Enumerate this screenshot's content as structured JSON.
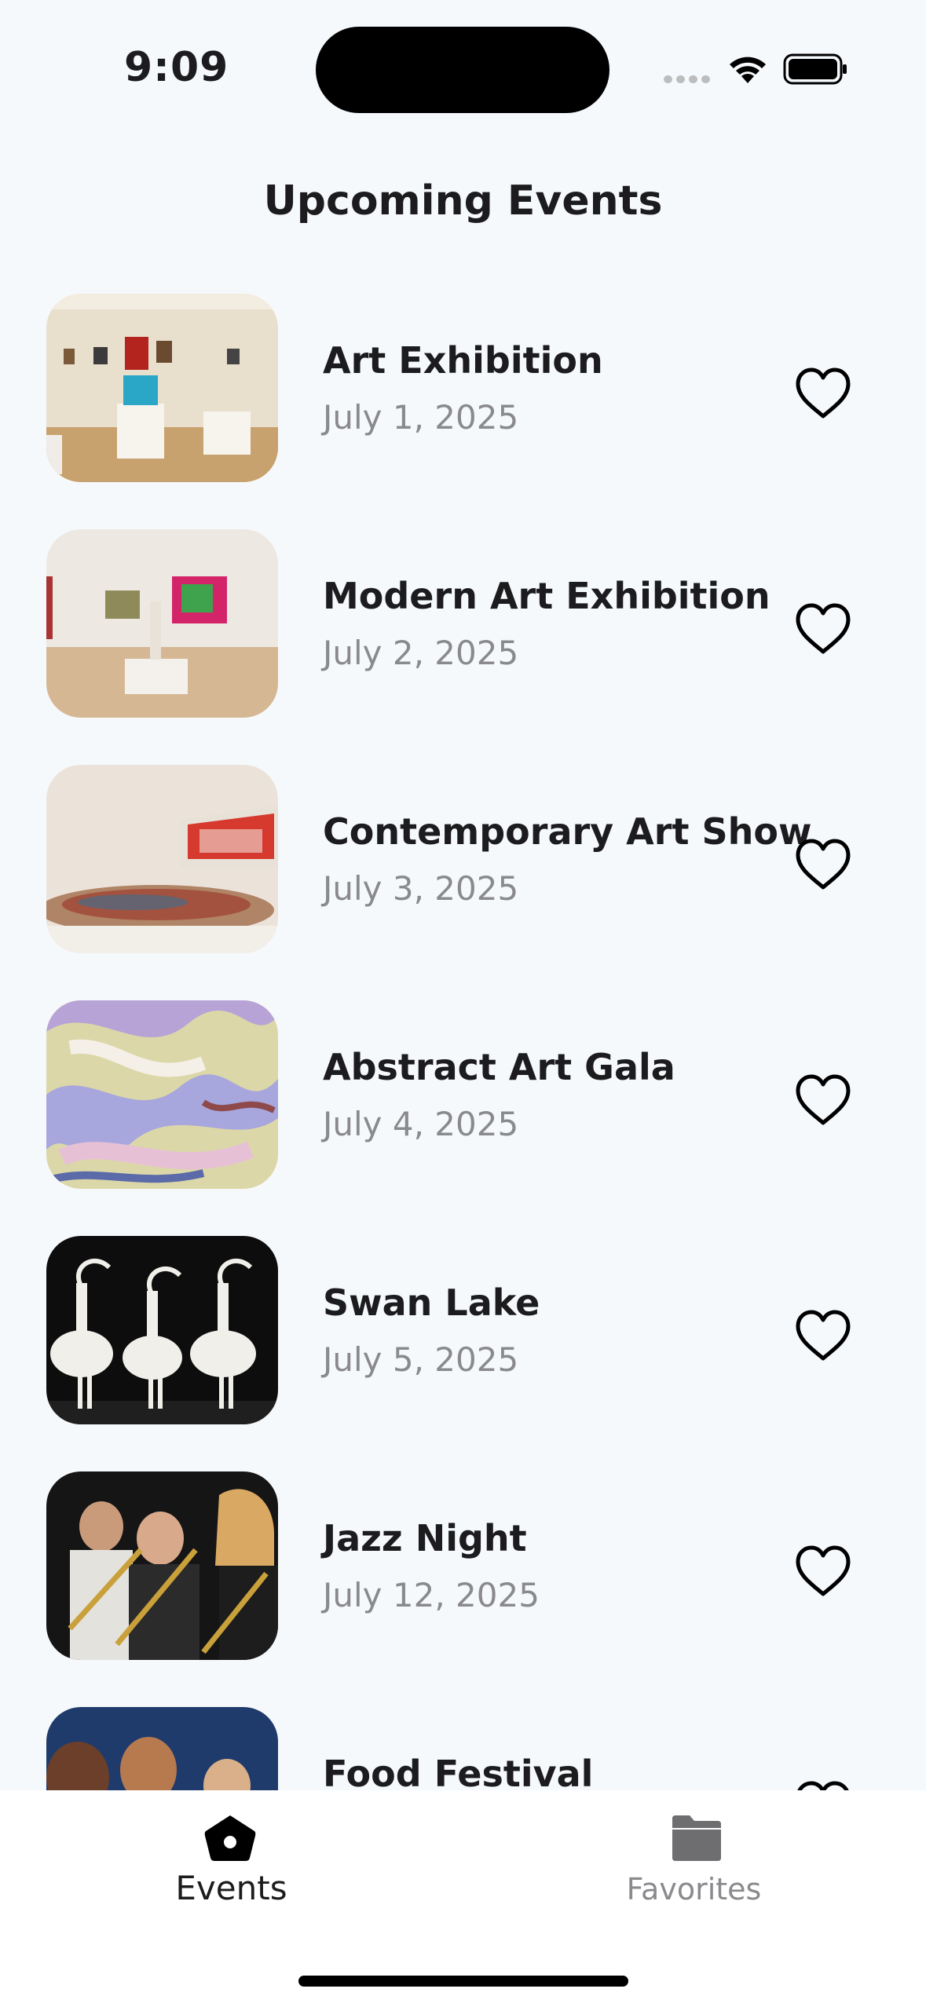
{
  "status_bar": {
    "time": "9:09"
  },
  "header": {
    "title": "Upcoming Events"
  },
  "events": [
    {
      "title": "Art Exhibition",
      "date": "July 1, 2025",
      "favorite_icon": "heart-outline"
    },
    {
      "title": "Modern Art Exhibition",
      "date": "July 2, 2025",
      "favorite_icon": "heart-outline"
    },
    {
      "title": "Contemporary Art Show",
      "date": "July 3, 2025",
      "favorite_icon": "heart-outline"
    },
    {
      "title": "Abstract Art Gala",
      "date": "July 4, 2025",
      "favorite_icon": "heart-outline"
    },
    {
      "title": "Swan Lake",
      "date": "July 5, 2025",
      "favorite_icon": "heart-outline"
    },
    {
      "title": "Jazz Night",
      "date": "July 12, 2025",
      "favorite_icon": "heart-outline"
    },
    {
      "title": "Food Festival",
      "date": "",
      "favorite_icon": "heart-outline"
    }
  ],
  "tab_bar": {
    "events": {
      "label": "Events",
      "icon": "home-icon",
      "active": true
    },
    "favorites": {
      "label": "Favorites",
      "icon": "folder-icon",
      "active": false
    }
  },
  "colors": {
    "background": "#f6f9fc",
    "text": "#1c1c1e",
    "secondary_text": "#8a8a8e",
    "tab_bar": "#ffffff"
  }
}
